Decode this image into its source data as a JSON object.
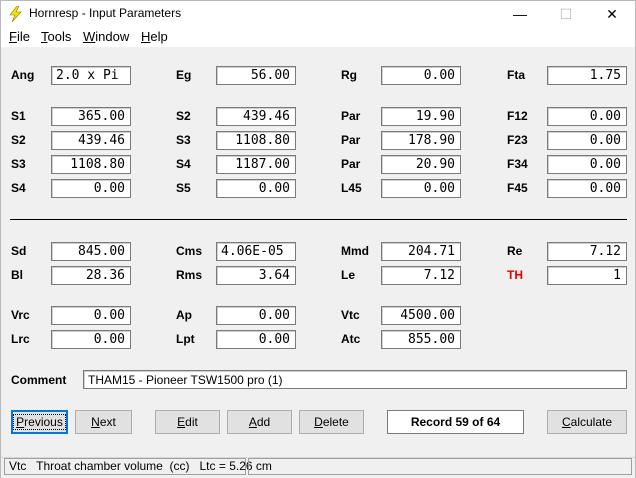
{
  "window": {
    "title": "Hornresp - Input Parameters",
    "icon": "lightning-bolt-icon",
    "controls": {
      "minimize": "—",
      "maximize": "☐",
      "close": "✕"
    }
  },
  "menu": [
    {
      "label": "File",
      "accel": "F",
      "rest": "ile"
    },
    {
      "label": "Tools",
      "accel": "T",
      "rest": "ools"
    },
    {
      "label": "Window",
      "accel": "W",
      "rest": "indow"
    },
    {
      "label": "Help",
      "accel": "H",
      "rest": "elp"
    }
  ],
  "fields": {
    "ang": {
      "label": "Ang",
      "value": "2.0 x Pi"
    },
    "eg": {
      "label": "Eg",
      "value": "56.00"
    },
    "rg": {
      "label": "Rg",
      "value": "0.00"
    },
    "fta": {
      "label": "Fta",
      "value": "1.75"
    },
    "s1": {
      "label": "S1",
      "value": "365.00"
    },
    "s2a": {
      "label": "S2",
      "value": "439.46"
    },
    "par1": {
      "label": "Par",
      "value": "19.90"
    },
    "f12": {
      "label": "F12",
      "value": "0.00"
    },
    "s2b": {
      "label": "S2",
      "value": "439.46"
    },
    "s3a": {
      "label": "S3",
      "value": "1108.80"
    },
    "par2": {
      "label": "Par",
      "value": "178.90"
    },
    "f23": {
      "label": "F23",
      "value": "0.00"
    },
    "s3b": {
      "label": "S3",
      "value": "1108.80"
    },
    "s4a": {
      "label": "S4",
      "value": "1187.00"
    },
    "par3": {
      "label": "Par",
      "value": "20.90"
    },
    "f34": {
      "label": "F34",
      "value": "0.00"
    },
    "s4b": {
      "label": "S4",
      "value": "0.00"
    },
    "s5": {
      "label": "S5",
      "value": "0.00"
    },
    "l45": {
      "label": "L45",
      "value": "0.00"
    },
    "f45": {
      "label": "F45",
      "value": "0.00"
    },
    "sd": {
      "label": "Sd",
      "value": "845.00"
    },
    "cms": {
      "label": "Cms",
      "value": "4.06E-05"
    },
    "mmd": {
      "label": "Mmd",
      "value": "204.71"
    },
    "re": {
      "label": "Re",
      "value": "7.12"
    },
    "bl": {
      "label": "Bl",
      "value": "28.36"
    },
    "rms": {
      "label": "Rms",
      "value": "3.64"
    },
    "le": {
      "label": "Le",
      "value": "7.12"
    },
    "th": {
      "label": "TH",
      "value": "1",
      "label_color": "#e00000"
    },
    "vrc": {
      "label": "Vrc",
      "value": "0.00"
    },
    "ap": {
      "label": "Ap",
      "value": "0.00"
    },
    "vtc": {
      "label": "Vtc",
      "value": "4500.00"
    },
    "lrc": {
      "label": "Lrc",
      "value": "0.00"
    },
    "lpt": {
      "label": "Lpt",
      "value": "0.00"
    },
    "atc": {
      "label": "Atc",
      "value": "855.00"
    }
  },
  "comment": {
    "label": "Comment",
    "value": "THAM15 - Pioneer TSW1500 pro (1)"
  },
  "buttons": {
    "previous": {
      "label": "Previous",
      "accel": "P",
      "rest": "revious"
    },
    "next": {
      "label": "Next",
      "accel": "N",
      "rest": "ext"
    },
    "edit": {
      "label": "Edit",
      "accel": "E",
      "rest": "dit"
    },
    "add": {
      "label": "Add",
      "accel": "A",
      "rest": "dd"
    },
    "delete": {
      "label": "Delete",
      "accel": "D",
      "rest": "elete"
    },
    "calculate": {
      "label": "Calculate",
      "accel": "C",
      "rest": "alculate"
    }
  },
  "record": "Record 59 of 64",
  "status": "Vtc   Throat chamber volume  (cc)   Ltc = 5.26 cm"
}
